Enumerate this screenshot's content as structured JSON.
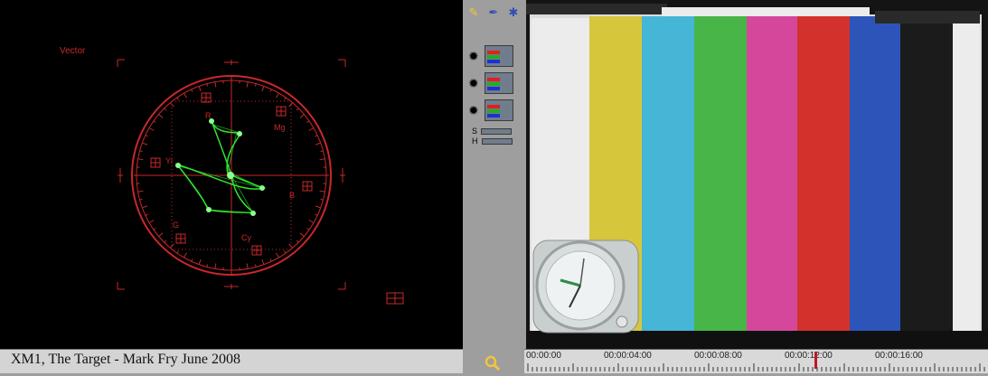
{
  "scope": {
    "title": "Vector",
    "targets": {
      "r": "R",
      "mg": "Mg",
      "yl": "Yl",
      "b": "B",
      "g": "G",
      "cy": "Cy"
    },
    "colors": {
      "graticule": "#c8282a",
      "trace": "#33ff33",
      "background": "#000000"
    }
  },
  "caption": "XM1, The Target  - Mark Fry June 2008",
  "toolbar": {
    "icons": [
      "brush-icon",
      "pen-icon",
      "color-wheel-icon"
    ]
  },
  "channels": [
    {
      "icon": "gear-icon"
    },
    {
      "icon": "gear-icon"
    },
    {
      "icon": "gear-icon"
    }
  ],
  "sliders": {
    "s_label": "S",
    "h_label": "H"
  },
  "video": {
    "colors": {
      "white": "#e9e9e9",
      "yellow": "#d6c63b",
      "cyan": "#45b6d6",
      "green": "#47b548",
      "magenta": "#d4479a",
      "red": "#d2322b",
      "blue": "#2d55b9",
      "black": "#1b1b1b"
    }
  },
  "timeline": {
    "labels": [
      "00:00:00",
      "00:00:04:00",
      "00:00:08:00",
      "00:00:12:00",
      "00:00:16:00"
    ]
  },
  "magnifier": {
    "icon": "magnifier-icon"
  }
}
